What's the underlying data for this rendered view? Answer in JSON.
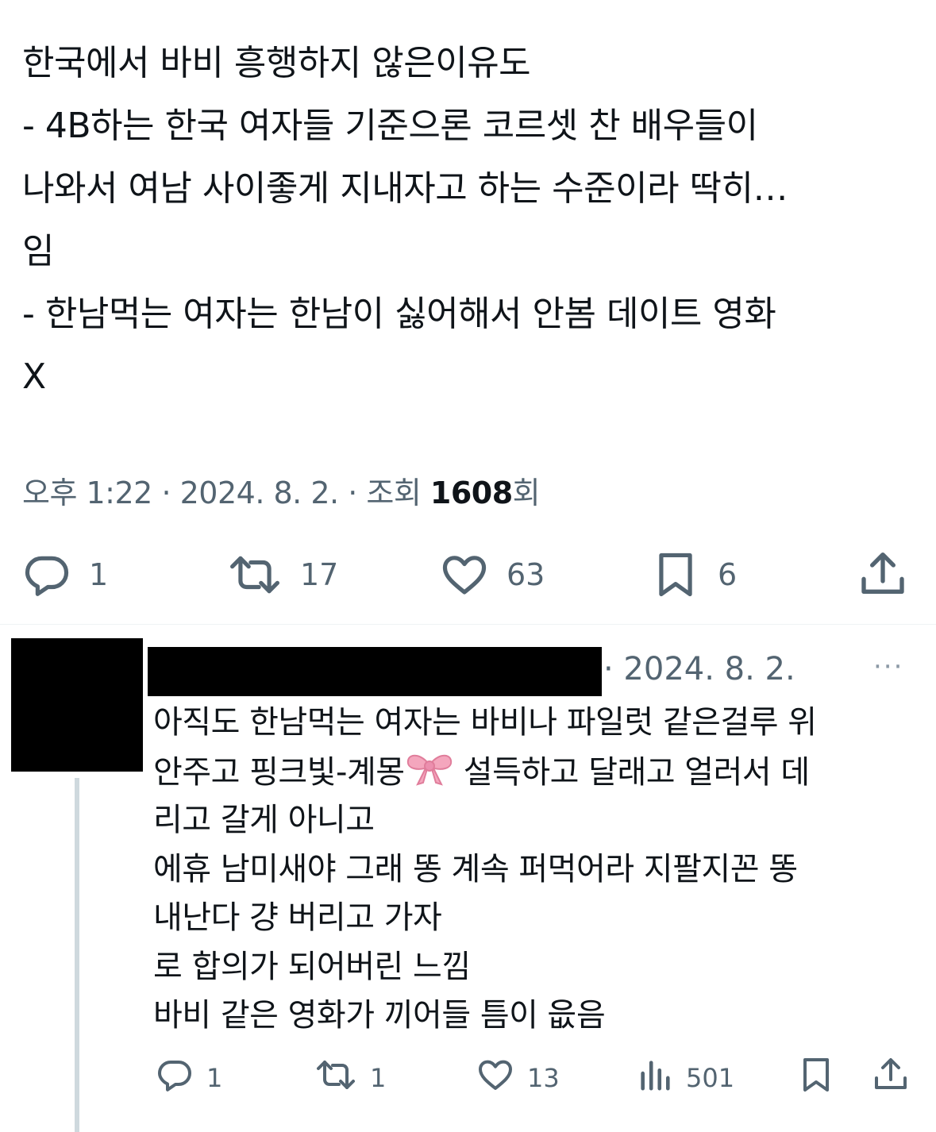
{
  "tweet": {
    "lines": [
      "한국에서 바비 흥행하지 않은이유도",
      "- 4B하는 한국 여자들 기준으론 코르셋 찬 배우들이",
      "나와서 여남 사이좋게 지내자고 하는 수준이라 딱히…",
      "임",
      "- 한남먹는 여자는 한남이 싫어해서 안봄 데이트 영화",
      "X"
    ],
    "time": "오후 1:22",
    "date": "2024. 8. 2.",
    "views_label": "조회",
    "views_count": "1608",
    "views_suffix": "회",
    "separator": "·",
    "actions": {
      "reply_count": "1",
      "retweet_count": "17",
      "like_count": "63",
      "bookmark_count": "6"
    }
  },
  "reply": {
    "date": "· 2024. 8. 2.",
    "more": "···",
    "lines": [
      "아직도 한남먹는 여자는 바비나 파일럿 같은걸루 위",
      "안주고 핑크빛-계몽",
      "설득하고 달래고 얼러서 데",
      "리고 갈게 아니고",
      "에휴 남미새야 그래 똥 계속 퍼먹어라 지팔지꼰 똥",
      "내난다 걍 버리고 가자",
      "로 합의가 되어버린 느낌",
      "바비 같은 영화가 끼어들 틈이 읎음"
    ],
    "actions": {
      "reply_count": "1",
      "retweet_count": "1",
      "like_count": "13",
      "views_count": "501"
    }
  },
  "colors": {
    "text": "#0f1419",
    "secondary": "#536471",
    "divider": "#eff3f4",
    "thread_line": "#cfd9de",
    "bow": "#f4a6bd"
  },
  "icons": {
    "reply": "reply-icon",
    "retweet": "retweet-icon",
    "like": "heart-icon",
    "bookmark": "bookmark-icon",
    "share": "share-icon",
    "views": "views-bar-chart-icon",
    "emoji": "ribbon-emoji"
  }
}
